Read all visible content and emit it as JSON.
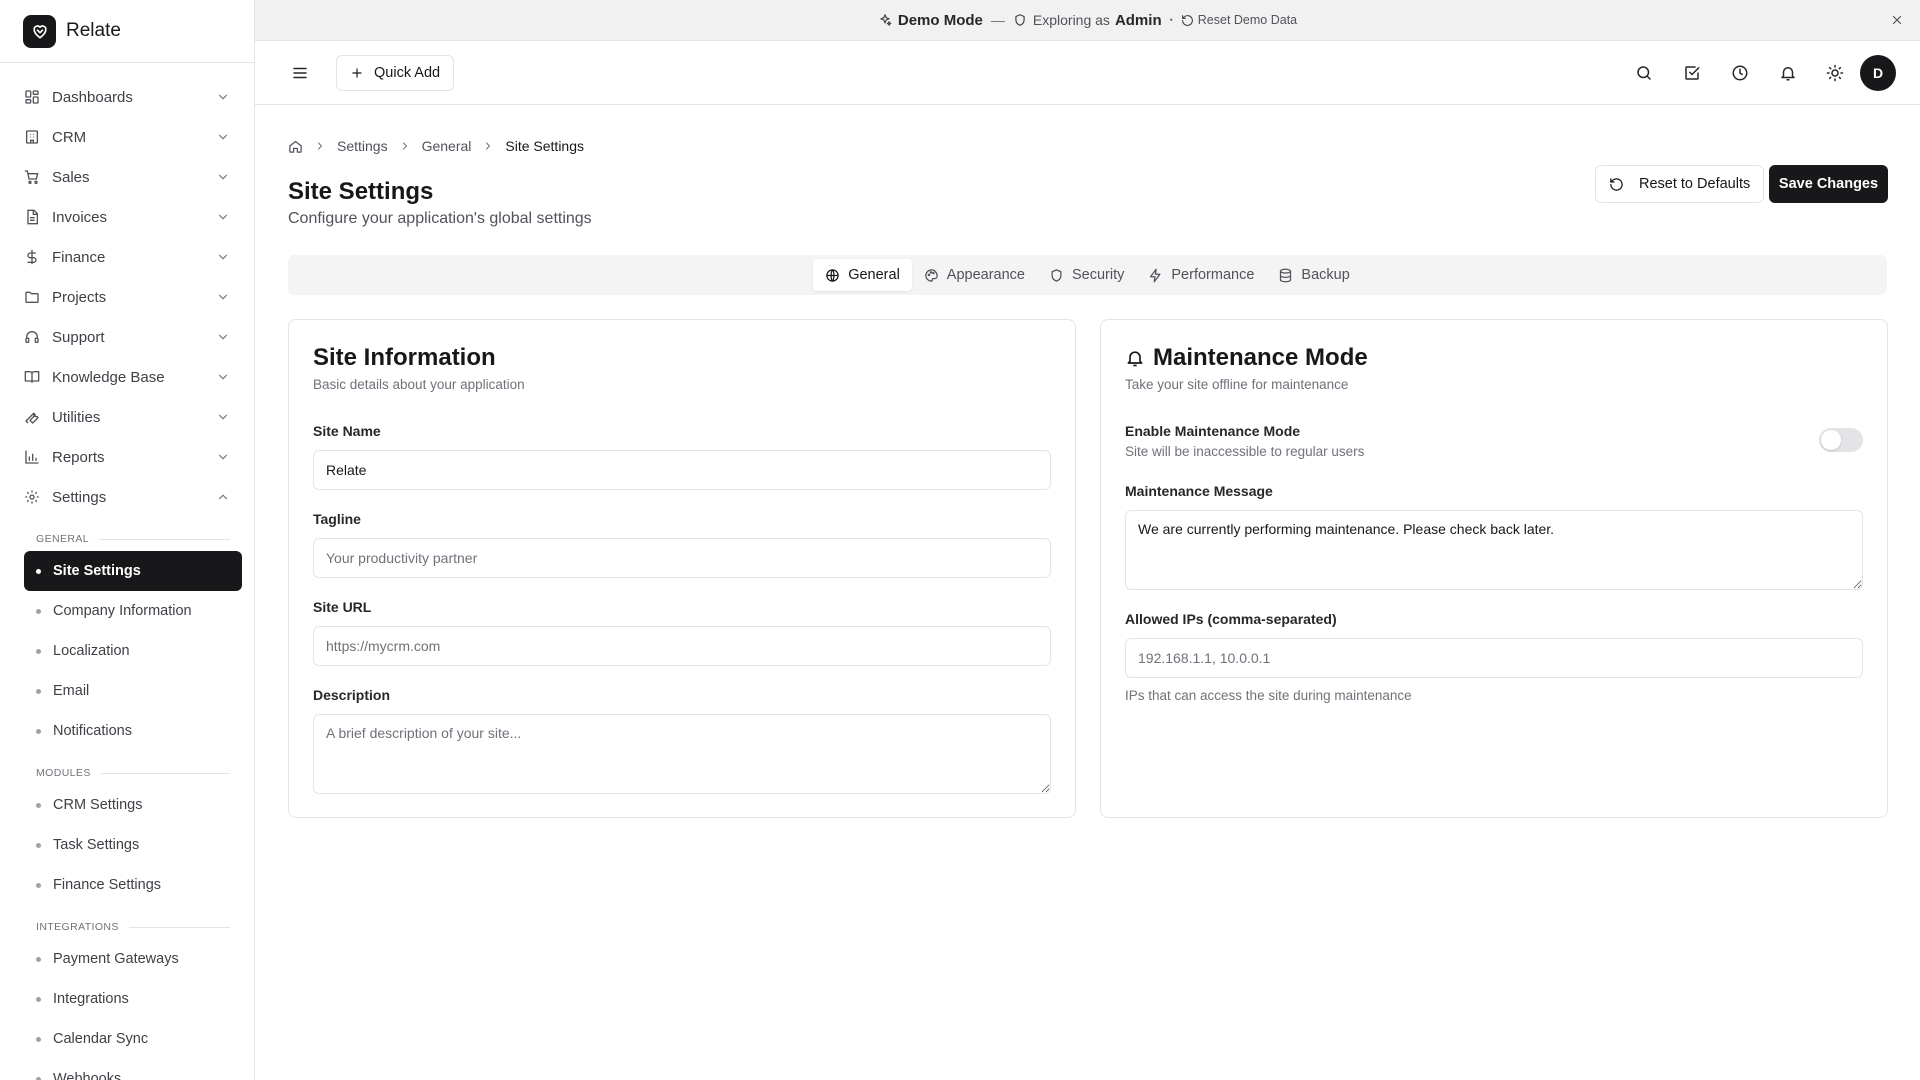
{
  "brand": {
    "name": "Relate"
  },
  "banner": {
    "mode_label": "Demo Mode",
    "separator": "—",
    "exploring_prefix": "Exploring as",
    "role": "Admin",
    "dot": "•",
    "reset_label": "Reset Demo Data"
  },
  "sidebar": {
    "items": [
      {
        "label": "Dashboards",
        "icon": "dashboard-icon"
      },
      {
        "label": "CRM",
        "icon": "building-icon"
      },
      {
        "label": "Sales",
        "icon": "cart-icon"
      },
      {
        "label": "Invoices",
        "icon": "file-icon"
      },
      {
        "label": "Finance",
        "icon": "dollar-icon"
      },
      {
        "label": "Projects",
        "icon": "folder-icon"
      },
      {
        "label": "Support",
        "icon": "headset-icon"
      },
      {
        "label": "Knowledge Base",
        "icon": "book-icon"
      },
      {
        "label": "Utilities",
        "icon": "wrench-icon"
      },
      {
        "label": "Reports",
        "icon": "bar-chart-icon"
      },
      {
        "label": "Settings",
        "icon": "gear-icon"
      }
    ],
    "sections": {
      "general": {
        "title": "GENERAL",
        "items": [
          "Site Settings",
          "Company Information",
          "Localization",
          "Email",
          "Notifications"
        ]
      },
      "modules": {
        "title": "MODULES",
        "items": [
          "CRM Settings",
          "Task Settings",
          "Finance Settings"
        ]
      },
      "integrations": {
        "title": "INTEGRATIONS",
        "items": [
          "Payment Gateways",
          "Integrations",
          "Calendar Sync",
          "Webhooks"
        ]
      }
    }
  },
  "topbar": {
    "quick_add_label": "Quick Add",
    "avatar_initial": "D"
  },
  "breadcrumb": {
    "items": [
      "Settings",
      "General",
      "Site Settings"
    ]
  },
  "page": {
    "title": "Site Settings",
    "subtitle": "Configure your application's global settings",
    "reset_label": "Reset to Defaults",
    "save_label": "Save Changes"
  },
  "tabs": [
    {
      "label": "General",
      "icon": "globe-icon",
      "active": true
    },
    {
      "label": "Appearance",
      "icon": "palette-icon",
      "active": false
    },
    {
      "label": "Security",
      "icon": "shield-icon",
      "active": false
    },
    {
      "label": "Performance",
      "icon": "lightning-icon",
      "active": false
    },
    {
      "label": "Backup",
      "icon": "database-icon",
      "active": false
    }
  ],
  "site_info": {
    "title": "Site Information",
    "description": "Basic details about your application",
    "site_name_label": "Site Name",
    "site_name_value": "Relate",
    "tagline_label": "Tagline",
    "tagline_placeholder": "Your productivity partner",
    "site_url_label": "Site URL",
    "site_url_placeholder": "https://mycrm.com",
    "description_label": "Description",
    "description_placeholder": "A brief description of your site..."
  },
  "maintenance": {
    "title": "Maintenance Mode",
    "description": "Take your site offline for maintenance",
    "enable_label": "Enable Maintenance Mode",
    "enable_desc": "Site will be inaccessible to regular users",
    "enabled": false,
    "message_label": "Maintenance Message",
    "message_value": "We are currently performing maintenance. Please check back later.",
    "ips_label": "Allowed IPs (comma-separated)",
    "ips_placeholder": "192.168.1.1, 10.0.0.1",
    "ips_hint": "IPs that can access the site during maintenance"
  },
  "colors": {
    "primary": "#18181b",
    "border": "#e4e4e7",
    "muted_text": "#71717a",
    "banner_bg": "#f1f1f1"
  }
}
